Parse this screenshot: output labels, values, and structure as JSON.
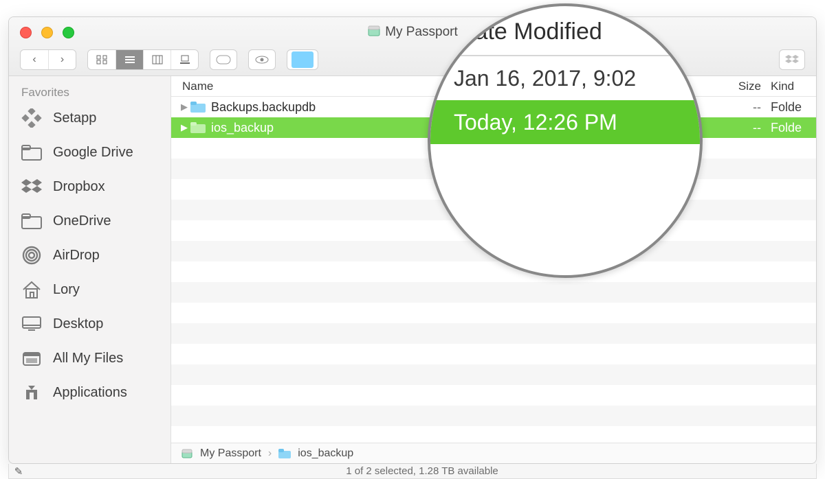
{
  "window": {
    "title": "My Passport"
  },
  "sidebar": {
    "heading": "Favorites",
    "items": [
      {
        "icon": "setapp",
        "label": "Setapp"
      },
      {
        "icon": "folder",
        "label": "Google Drive"
      },
      {
        "icon": "dropbox",
        "label": "Dropbox"
      },
      {
        "icon": "folder",
        "label": "OneDrive"
      },
      {
        "icon": "airdrop",
        "label": "AirDrop"
      },
      {
        "icon": "home",
        "label": "Lory"
      },
      {
        "icon": "desktop",
        "label": "Desktop"
      },
      {
        "icon": "allfiles",
        "label": "All My Files"
      },
      {
        "icon": "apps",
        "label": "Applications"
      }
    ]
  },
  "columns": {
    "name": "Name",
    "size": "Size",
    "kind": "Kind"
  },
  "rows": [
    {
      "name": "Backups.backupdb",
      "date": "Jan 16, 2017, 9:02",
      "size": "--",
      "kind": "Folde",
      "selected": false
    },
    {
      "name": "ios_backup",
      "date": "Today, 12:26 PM",
      "size": "--",
      "kind": "Folde",
      "selected": true
    }
  ],
  "magnifier": {
    "header": "Date Modified",
    "line1": "Jan 16, 2017, 9:02",
    "line2": "Today, 12:26 PM"
  },
  "pathbar": {
    "root": "My Passport",
    "leaf": "ios_backup"
  },
  "status": {
    "text": "1 of 2 selected, 1.28 TB available"
  }
}
